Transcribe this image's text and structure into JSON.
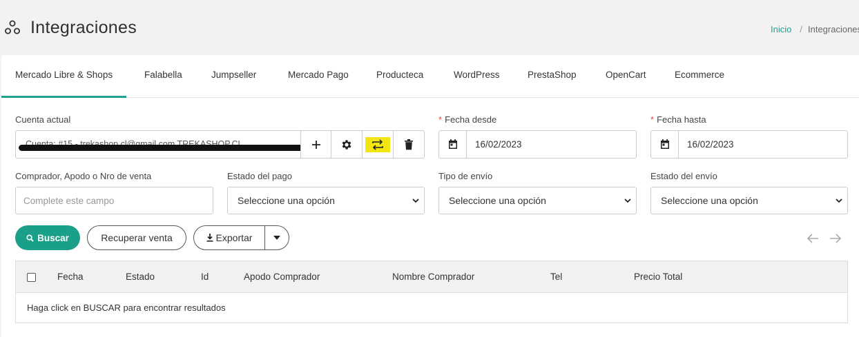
{
  "header": {
    "title": "Integraciones",
    "breadcrumb": {
      "home": "Inicio",
      "current": "Integraciones"
    }
  },
  "tabs": [
    {
      "label": "Mercado Libre & Shops",
      "active": true
    },
    {
      "label": "Falabella"
    },
    {
      "label": "Jumpseller"
    },
    {
      "label": "Mercado Pago"
    },
    {
      "label": "Producteca"
    },
    {
      "label": "WordPress"
    },
    {
      "label": "PrestaShop"
    },
    {
      "label": "OpenCart"
    },
    {
      "label": "Ecommerce"
    }
  ],
  "filters": {
    "account_label": "Cuenta actual",
    "account_value": "Cuenta: #15 - trekashop.cl@gmail.com TREKASHOP.CL",
    "date_from_label": "Fecha desde",
    "date_from_value": "16/02/2023",
    "date_to_label": "Fecha hasta",
    "date_to_value": "16/02/2023",
    "buyer_label": "Comprador, Apodo o Nro de venta",
    "buyer_placeholder": "Complete este campo",
    "payment_status_label": "Estado del pago",
    "payment_status_value": "Seleccione una opción",
    "shipping_type_label": "Tipo de envío",
    "shipping_type_value": "Seleccione una opción",
    "shipping_status_label": "Estado del envío",
    "shipping_status_value": "Seleccione una opción"
  },
  "actions": {
    "search": "Buscar",
    "recover": "Recuperar venta",
    "export": "Exportar"
  },
  "table": {
    "columns": [
      "Fecha",
      "Estado",
      "Id",
      "Apodo Comprador",
      "Nombre Comprador",
      "Tel",
      "Precio Total"
    ],
    "empty_message": "Haga click en BUSCAR para encontrar resultados"
  },
  "colors": {
    "accent": "#1a9f89",
    "highlight": "#f3e511",
    "required": "#e04848"
  },
  "icons": [
    "integrations-icon",
    "add-icon",
    "gear-icon",
    "sync-icon",
    "trash-icon",
    "calendar-icon",
    "search-icon",
    "download-icon",
    "chevron-down-icon",
    "arrow-left-icon",
    "arrow-right-icon"
  ]
}
